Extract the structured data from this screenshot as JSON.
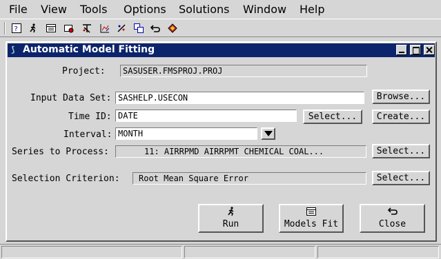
{
  "menubar": {
    "items": [
      "File",
      "View",
      "Tools",
      "Options",
      "Solutions",
      "Window",
      "Help"
    ]
  },
  "toolbar": {
    "icons": [
      "help-icon",
      "run-icon",
      "table-icon",
      "view-icon",
      "tools-icon",
      "graph-icon",
      "fit-icon",
      "copy-icon",
      "undo-icon",
      "book-icon"
    ]
  },
  "dialog": {
    "title": "Automatic Model Fitting",
    "project_label": "Project:",
    "project_value": "SASUSER.FMSPROJ.PROJ",
    "input_data_set_label": "Input Data Set:",
    "input_data_set_value": "SASHELP.USECON",
    "browse_label": "Browse...",
    "time_id_label": "Time ID:",
    "time_id_value": "DATE",
    "time_id_select_label": "Select...",
    "create_label": "Create...",
    "interval_label": "Interval:",
    "interval_value": "MONTH",
    "series_label": "Series to Process:",
    "series_value": "11: AIRRPMD AIRRPMT CHEMICAL COAL...",
    "series_select_label": "Select...",
    "criterion_label": "Selection Criterion:",
    "criterion_value": "Root Mean Square Error",
    "criterion_select_label": "Select...",
    "run_label": "Run",
    "models_fit_label": "Models Fit",
    "close_label": "Close"
  }
}
